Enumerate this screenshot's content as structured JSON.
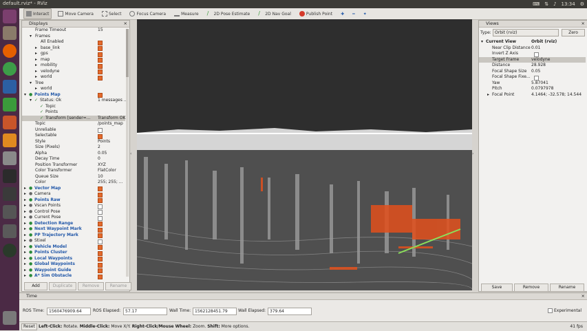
{
  "window": {
    "title": "default.rviz* - RViz",
    "clock": "13:34"
  },
  "toolbar": {
    "tools": [
      "Interact",
      "Move Camera",
      "Select",
      "Focus Camera",
      "Measure",
      "2D Pose Estimate",
      "2D Nav Goal",
      "Publish Point"
    ]
  },
  "displays": {
    "title": "Displays",
    "rows": [
      {
        "label": "Frame Timeout",
        "value": "15",
        "indent": 1
      },
      {
        "label": "Frames",
        "indent": 1,
        "arrow": "v"
      },
      {
        "label": "All Enabled",
        "indent": 2,
        "check": true
      },
      {
        "label": "base_link",
        "indent": 2,
        "arrow": ">",
        "check": true
      },
      {
        "label": "gps",
        "indent": 2,
        "arrow": ">",
        "check": true
      },
      {
        "label": "map",
        "indent": 2,
        "arrow": ">",
        "check": true
      },
      {
        "label": "mobility",
        "indent": 2,
        "arrow": ">",
        "check": true
      },
      {
        "label": "velodyne",
        "indent": 2,
        "arrow": ">",
        "check": true
      },
      {
        "label": "world",
        "indent": 2,
        "arrow": ">",
        "check": true
      },
      {
        "label": "Tree",
        "indent": 1,
        "arrow": "v"
      },
      {
        "label": "world",
        "indent": 2,
        "arrow": ">"
      },
      {
        "label": "Points Map",
        "indent": 0,
        "arrow": "v",
        "check": true,
        "blue": true
      },
      {
        "label": "Status: Ok",
        "indent": 1,
        "arrow": "v",
        "tick": true,
        "value": "1 messages ..."
      },
      {
        "label": "Topic",
        "indent": 2,
        "tick": true
      },
      {
        "label": "Points",
        "indent": 2,
        "tick": true
      },
      {
        "label": "Transform [sender=...",
        "indent": 2,
        "tick": true,
        "value": "Transform OK",
        "sel": true
      },
      {
        "label": "Topic",
        "indent": 1,
        "value": "/points_map"
      },
      {
        "label": "Unreliable",
        "indent": 1,
        "check": false
      },
      {
        "label": "Selectable",
        "indent": 1,
        "check": true
      },
      {
        "label": "Style",
        "indent": 1,
        "value": "Points"
      },
      {
        "label": "Size (Pixels)",
        "indent": 1,
        "value": "2"
      },
      {
        "label": "Alpha",
        "indent": 1,
        "value": "0.05"
      },
      {
        "label": "Decay Time",
        "indent": 1,
        "value": "0"
      },
      {
        "label": "Position Transformer",
        "indent": 1,
        "value": "XYZ"
      },
      {
        "label": "Color Transformer",
        "indent": 1,
        "value": "FlatColor"
      },
      {
        "label": "Queue Size",
        "indent": 1,
        "value": "10"
      },
      {
        "label": "Color",
        "indent": 1,
        "value": "255; 255; ..."
      },
      {
        "label": "Vector Map",
        "indent": 0,
        "arrow": ">",
        "check": true,
        "blue": true
      },
      {
        "label": "Camera",
        "indent": 0,
        "arrow": ">",
        "check": true
      },
      {
        "label": "Points Raw",
        "indent": 0,
        "arrow": ">",
        "check": true,
        "blue": true
      },
      {
        "label": "Vscan Points",
        "indent": 0,
        "arrow": ">",
        "check": false
      },
      {
        "label": "Control Pose",
        "indent": 0,
        "arrow": ">",
        "check": false
      },
      {
        "label": "Current Pose",
        "indent": 0,
        "arrow": ">",
        "check": false
      },
      {
        "label": "Detection Range",
        "indent": 0,
        "arrow": ">",
        "check": true,
        "blue": true
      },
      {
        "label": "Next Waypoint Mark",
        "indent": 0,
        "arrow": ">",
        "check": true,
        "blue": true
      },
      {
        "label": "PP Trajectory Mark",
        "indent": 0,
        "arrow": ">",
        "check": true,
        "blue": true
      },
      {
        "label": "Stixel",
        "indent": 0,
        "arrow": ">",
        "check": false
      },
      {
        "label": "Vehicle Model",
        "indent": 0,
        "arrow": ">",
        "check": true,
        "blue": true
      },
      {
        "label": "Points Cluster",
        "indent": 0,
        "arrow": ">",
        "check": true,
        "blue": true
      },
      {
        "label": "Local Waypoints",
        "indent": 0,
        "arrow": ">",
        "check": true,
        "blue": true
      },
      {
        "label": "Global Waypoints",
        "indent": 0,
        "arrow": ">",
        "check": true,
        "blue": true
      },
      {
        "label": "Waypoint Guide",
        "indent": 0,
        "arrow": ">",
        "check": true,
        "blue": true
      },
      {
        "label": "A* Sim Obstacle",
        "indent": 0,
        "arrow": ">",
        "check": true,
        "blue": true
      }
    ],
    "buttons": [
      "Add",
      "Duplicate",
      "Remove",
      "Rename"
    ]
  },
  "views": {
    "title": "Views",
    "type_label": "Type:",
    "type_value": "Orbit (rviz)",
    "zero": "Zero",
    "rows": [
      {
        "label": "Current View",
        "value": "Orbit (rviz)",
        "bold": true,
        "arrow": "v"
      },
      {
        "label": "Near Clip Distance",
        "value": "0.01"
      },
      {
        "label": "Invert Z Axis",
        "check": false
      },
      {
        "label": "Target Frame",
        "value": "velodyne",
        "sel": true
      },
      {
        "label": "Distance",
        "value": "28.928"
      },
      {
        "label": "Focal Shape Size",
        "value": "0.05"
      },
      {
        "label": "Focal Shape Fixe...",
        "check": false
      },
      {
        "label": "Yaw",
        "value": "5.87041"
      },
      {
        "label": "Pitch",
        "value": "0.0797978"
      },
      {
        "label": "Focal Point",
        "value": "4.1464; -32.578; 14.544",
        "arrow": ">"
      }
    ],
    "buttons": [
      "Save",
      "Remove",
      "Rename"
    ]
  },
  "time": {
    "title": "Time",
    "ros_time_label": "ROS Time:",
    "ros_time": "1560476909.64",
    "ros_elapsed_label": "ROS Elapsed:",
    "ros_elapsed": "57.17",
    "wall_time_label": "Wall Time:",
    "wall_time": "1562128451.79",
    "wall_elapsed_label": "Wall Elapsed:",
    "wall_elapsed": "379.64",
    "experimental": "Experimental"
  },
  "status": {
    "reset": "Reset",
    "hint_left": "Left-Click:",
    "hint_left_text": " Rotate. ",
    "hint_mid": "Middle-Click:",
    "hint_mid_text": " Move X/Y. ",
    "hint_right": "Right-Click/Mouse Wheel:",
    "hint_right_text": " Zoom. ",
    "hint_shift": "Shift:",
    "hint_shift_text": " More options.",
    "fps": "41 fps"
  },
  "colors": {
    "accent": "#e46a2c",
    "launcher": "#4b2a45",
    "titlebar": "#3c3b37",
    "viewport": "#2e2e2e",
    "highlight": "#2157a8"
  }
}
